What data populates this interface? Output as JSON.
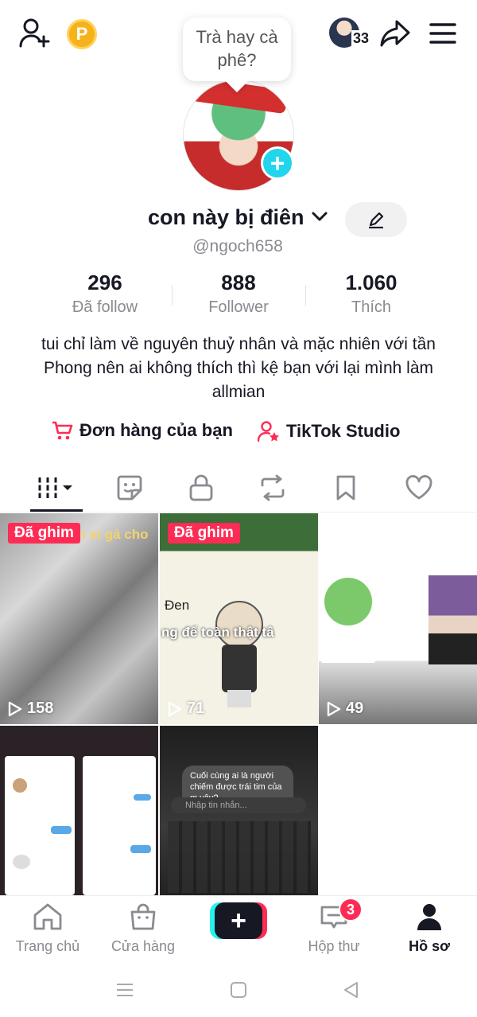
{
  "colors": {
    "brand_red": "#fe2c55",
    "brand_cyan": "#25f4ee",
    "text": "#161823",
    "muted": "#8a8b91"
  },
  "topbar": {
    "add_friend_icon": "person-plus-icon",
    "coin_label": "P",
    "friends_count": "33",
    "share_icon": "share-arrow-icon",
    "menu_icon": "hamburger-icon"
  },
  "note": {
    "text": "Trà hay cà phê?"
  },
  "profile": {
    "name": "con này bị điên",
    "handle": "@ngoch658",
    "bio": "tui chỉ làm về nguyên thuỷ nhân và mặc nhiên với tần Phong nên ai không thích thì kệ bạn với lại mình làm allmian"
  },
  "stats": [
    {
      "value": "296",
      "label": "Đã follow"
    },
    {
      "value": "888",
      "label": "Follower"
    },
    {
      "value": "1.060",
      "label": "Thích"
    }
  ],
  "links": {
    "orders": "Đơn hàng của bạn",
    "studio": "TikTok Studio"
  },
  "tabs": [
    "videos",
    "stickers",
    "private",
    "reposts",
    "favorites",
    "liked"
  ],
  "videos": [
    {
      "pinned": "Đã ghim",
      "overlay": "ích ai gả cho",
      "views": "158"
    },
    {
      "pinned": "Đã ghim",
      "overlay_top": "Đen",
      "overlay": "ng để toàn thật tâ",
      "views": "71"
    },
    {
      "views": "49"
    },
    {
      "views": ""
    },
    {
      "chat_text": "Cuối cùng ai là người chiếm được trái tim của m vậy?",
      "input_placeholder": "Nhập tin nhắn..."
    }
  ],
  "bottomnav": {
    "home": "Trang chủ",
    "shop": "Cửa hàng",
    "create": "+",
    "inbox": "Hộp thư",
    "inbox_badge": "3",
    "profile": "Hồ sơ"
  }
}
